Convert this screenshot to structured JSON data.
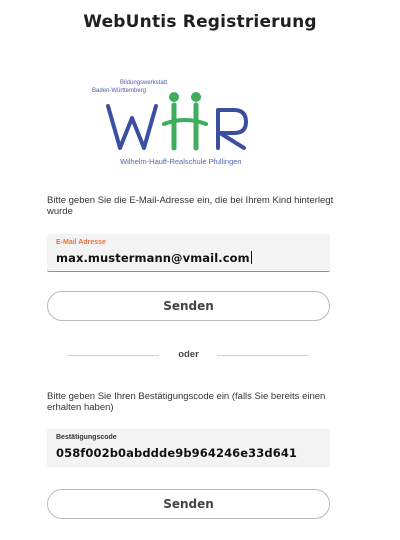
{
  "header": {
    "title": "WebUntis Registrierung"
  },
  "logo": {
    "line1": "Bildungswerkstatt",
    "line2": "Baden-Württemberg",
    "wordmark": "WHR",
    "caption": "Wilhelm-Hauff-Realschule Pfullingen",
    "colors": {
      "blue": "#3a4fa0",
      "green": "#3cae5c"
    }
  },
  "email_section": {
    "instruction": "Bitte geben Sie die E-Mail-Adresse ein, die bei Ihrem Kind hinterlegt wurde",
    "field_label": "E-Mail Adresse",
    "field_value": "max.mustermann@vmail.com",
    "label_color": "#e8753a",
    "button_label": "Senden"
  },
  "divider": {
    "text": "oder"
  },
  "code_section": {
    "instruction": "Bitte geben Sie Ihren Bestätigungscode ein (falls Sie bereits einen erhalten haben)",
    "field_label": "Bestätigungscode",
    "field_value": "058f002b0abddde9b964246e33d641",
    "label_color": "#333333",
    "button_label": "Senden"
  }
}
